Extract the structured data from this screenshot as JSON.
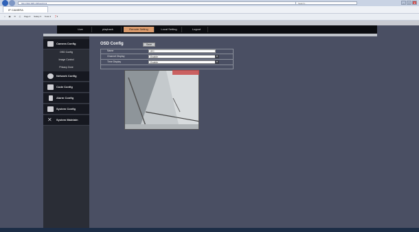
{
  "browser": {
    "address": "http://192.168.1.68/osd.html",
    "search_placeholder": "Search...",
    "tab_title": "IP CAMERA",
    "commands": [
      "Page ▾",
      "Safety ▾",
      "Tools ▾",
      "❓▾"
    ],
    "window_buttons": [
      "–",
      "□",
      "✕"
    ]
  },
  "topnav": {
    "items": [
      "Live",
      "playback",
      "Remote Setting",
      "Local Setting",
      "Logout"
    ],
    "active_color": "#d99a6c"
  },
  "sidebar": {
    "camera_config": {
      "label": "Camera Config",
      "sub_items": [
        "OSD Config",
        "Image Control",
        "Privacy Zone"
      ]
    },
    "groups": [
      "Network Config",
      "Code Config",
      "Alarm Config",
      "System Config",
      "System Maintain"
    ]
  },
  "osd": {
    "title": "OSD Config",
    "save_label": "Save",
    "fields": [
      {
        "label": "Name",
        "value": "IPC"
      },
      {
        "label": "Channel Display",
        "value": "Enable"
      },
      {
        "label": "Time Display",
        "value": "Enable"
      }
    ]
  }
}
